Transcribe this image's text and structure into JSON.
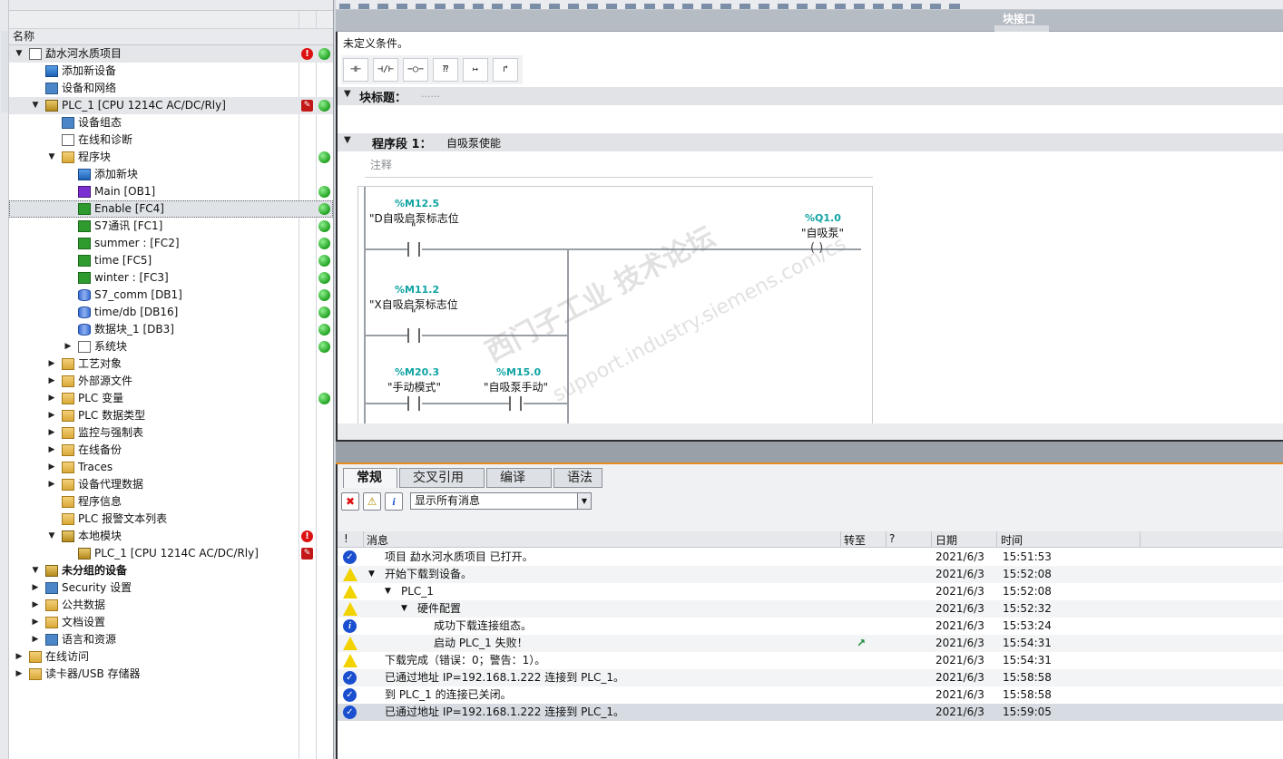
{
  "tree": {
    "header": "名称",
    "rows": [
      {
        "label": "勐水河水质项目",
        "indent": 0,
        "arrow": "down",
        "icon": "project-icon",
        "status1": "error",
        "status2": "ok"
      },
      {
        "label": "添加新设备",
        "indent": 1,
        "arrow": "",
        "icon": "add-device-icon",
        "status1": "",
        "status2": ""
      },
      {
        "label": "设备和网络",
        "indent": 1,
        "arrow": "",
        "icon": "network-icon",
        "status1": "",
        "status2": ""
      },
      {
        "label": "PLC_1 [CPU 1214C AC/DC/Rly]",
        "indent": 1,
        "arrow": "down",
        "icon": "plc-icon",
        "status1": "warn",
        "status2": "ok"
      },
      {
        "label": "设备组态",
        "indent": 2,
        "arrow": "",
        "icon": "device-config-icon",
        "status1": "",
        "status2": ""
      },
      {
        "label": "在线和诊断",
        "indent": 2,
        "arrow": "",
        "icon": "diagnostics-icon",
        "status1": "",
        "status2": ""
      },
      {
        "label": "程序块",
        "indent": 2,
        "arrow": "down",
        "icon": "program-blocks-icon",
        "status1": "",
        "status2": "ok"
      },
      {
        "label": "添加新块",
        "indent": 3,
        "arrow": "",
        "icon": "add-block-icon",
        "status1": "",
        "status2": ""
      },
      {
        "label": "Main [OB1]",
        "indent": 3,
        "arrow": "",
        "icon": "ob-icon",
        "status1": "",
        "status2": "ok"
      },
      {
        "label": "Enable [FC4]",
        "indent": 3,
        "arrow": "",
        "icon": "fc-icon",
        "status1": "",
        "status2": "ok"
      },
      {
        "label": "S7通讯 [FC1]",
        "indent": 3,
        "arrow": "",
        "icon": "fc-icon",
        "status1": "",
        "status2": "ok"
      },
      {
        "label": "summer : [FC2]",
        "indent": 3,
        "arrow": "",
        "icon": "fc-icon",
        "status1": "",
        "status2": "ok"
      },
      {
        "label": "time [FC5]",
        "indent": 3,
        "arrow": "",
        "icon": "fc-icon",
        "status1": "",
        "status2": "ok"
      },
      {
        "label": "winter : [FC3]",
        "indent": 3,
        "arrow": "",
        "icon": "fc-icon",
        "status1": "",
        "status2": "ok"
      },
      {
        "label": "S7_comm [DB1]",
        "indent": 3,
        "arrow": "",
        "icon": "db-icon",
        "status1": "",
        "status2": "ok"
      },
      {
        "label": "time/db [DB16]",
        "indent": 3,
        "arrow": "",
        "icon": "db-icon",
        "status1": "",
        "status2": "ok"
      },
      {
        "label": "数据块_1 [DB3]",
        "indent": 3,
        "arrow": "",
        "icon": "db-icon",
        "status1": "",
        "status2": "ok"
      },
      {
        "label": "系统块",
        "indent": 3,
        "arrow": "right",
        "icon": "system-blocks-icon",
        "status1": "",
        "status2": "ok"
      },
      {
        "label": "工艺对象",
        "indent": 2,
        "arrow": "right",
        "icon": "technology-objects-icon",
        "status1": "",
        "status2": ""
      },
      {
        "label": "外部源文件",
        "indent": 2,
        "arrow": "right",
        "icon": "folder-icon",
        "status1": "",
        "status2": ""
      },
      {
        "label": "PLC 变量",
        "indent": 2,
        "arrow": "right",
        "icon": "plc-tags-icon",
        "status1": "",
        "status2": "ok"
      },
      {
        "label": "PLC 数据类型",
        "indent": 2,
        "arrow": "right",
        "icon": "plc-data-types-icon",
        "status1": "",
        "status2": ""
      },
      {
        "label": "监控与强制表",
        "indent": 2,
        "arrow": "right",
        "icon": "watch-table-icon",
        "status1": "",
        "status2": ""
      },
      {
        "label": "在线备份",
        "indent": 2,
        "arrow": "right",
        "icon": "online-backup-icon",
        "status1": "",
        "status2": ""
      },
      {
        "label": "Traces",
        "indent": 2,
        "arrow": "right",
        "icon": "traces-icon",
        "status1": "",
        "status2": ""
      },
      {
        "label": "设备代理数据",
        "indent": 2,
        "arrow": "right",
        "icon": "proxy-data-icon",
        "status1": "",
        "status2": ""
      },
      {
        "label": "程序信息",
        "indent": 2,
        "arrow": "",
        "icon": "program-info-icon",
        "status1": "",
        "status2": ""
      },
      {
        "label": "PLC 报警文本列表",
        "indent": 2,
        "arrow": "",
        "icon": "alarm-text-icon",
        "status1": "",
        "status2": ""
      },
      {
        "label": "本地模块",
        "indent": 2,
        "arrow": "down",
        "icon": "local-modules-icon",
        "status1": "error",
        "status2": ""
      },
      {
        "label": "PLC_1 [CPU 1214C AC/DC/Rly]",
        "indent": 3,
        "arrow": "",
        "icon": "plc-icon",
        "status1": "warn",
        "status2": ""
      },
      {
        "label": "未分组的设备",
        "indent": 1,
        "arrow": "down",
        "icon": "ungrouped-devices-icon",
        "status1": "",
        "status2": "",
        "bold": true
      },
      {
        "label": "Security 设置",
        "indent": 1,
        "arrow": "right",
        "icon": "security-icon",
        "status1": "",
        "status2": ""
      },
      {
        "label": "公共数据",
        "indent": 1,
        "arrow": "right",
        "icon": "common-data-icon",
        "status1": "",
        "status2": ""
      },
      {
        "label": "文档设置",
        "indent": 1,
        "arrow": "right",
        "icon": "document-settings-icon",
        "status1": "",
        "status2": ""
      },
      {
        "label": "语言和资源",
        "indent": 1,
        "arrow": "right",
        "icon": "languages-icon",
        "status1": "",
        "status2": ""
      },
      {
        "label": "在线访问",
        "indent": 0,
        "arrow": "right",
        "icon": "online-access-icon",
        "status1": "",
        "status2": ""
      },
      {
        "label": "读卡器/USB 存储器",
        "indent": 0,
        "arrow": "right",
        "icon": "card-reader-icon",
        "status1": "",
        "status2": ""
      }
    ]
  },
  "editor": {
    "block_interface": "块接口",
    "condition": "未定义条件。",
    "lad_buttons": [
      "⊣⊢",
      "⊣/⊢",
      "−○−",
      "⁇",
      "↦",
      "↱"
    ],
    "block_title_label": "块标题：",
    "block_title_value": "......",
    "network_label": "程序段 1：",
    "network_title": "自吸泵使能",
    "comment": "注释",
    "contacts": [
      {
        "addr": "%M12.5",
        "tag": "\"D自吸启泵标志位",
        "tag2": "\""
      },
      {
        "addr": "%M11.2",
        "tag": "\"X自吸启泵标志位",
        "tag2": "\""
      },
      {
        "addr": "%M20.3",
        "tag": "\"手动模式\""
      },
      {
        "addr": "%M15.0",
        "tag": "\"自吸泵手动\""
      }
    ],
    "coil": {
      "addr": "%Q1.0",
      "tag": "\"自吸泵\""
    }
  },
  "inspector": {
    "tabs": [
      "常规",
      "交叉引用",
      "编译",
      "语法"
    ],
    "filter": "显示所有消息",
    "columns": {
      "bang": "!",
      "message": "消息",
      "goto": "转至",
      "q": "?",
      "date": "日期",
      "time": "时间"
    },
    "messages": [
      {
        "type": "ok",
        "indent": 0,
        "arrow": "",
        "text": "项目 勐水河水质项目 已打开。",
        "goto": "",
        "date": "2021/6/3",
        "time": "15:51:53"
      },
      {
        "type": "warn",
        "indent": 0,
        "arrow": "down",
        "text": "开始下载到设备。",
        "goto": "",
        "date": "2021/6/3",
        "time": "15:52:08"
      },
      {
        "type": "warn",
        "indent": 1,
        "arrow": "down",
        "text": "PLC_1",
        "goto": "",
        "date": "2021/6/3",
        "time": "15:52:08"
      },
      {
        "type": "warn",
        "indent": 2,
        "arrow": "down",
        "text": "硬件配置",
        "goto": "",
        "date": "2021/6/3",
        "time": "15:52:32"
      },
      {
        "type": "info",
        "indent": 3,
        "arrow": "",
        "text": "成功下载连接组态。",
        "goto": "",
        "date": "2021/6/3",
        "time": "15:53:24"
      },
      {
        "type": "warn",
        "indent": 3,
        "arrow": "",
        "text": "启动 PLC_1 失败！",
        "goto": "↗",
        "date": "2021/6/3",
        "time": "15:54:31"
      },
      {
        "type": "warn",
        "indent": 0,
        "arrow": "",
        "text": "下载完成（错误：0；警告：1）。",
        "goto": "",
        "date": "2021/6/3",
        "time": "15:54:31"
      },
      {
        "type": "ok",
        "indent": 0,
        "arrow": "",
        "text": "已通过地址 IP=192.168.1.222 连接到 PLC_1。",
        "goto": "",
        "date": "2021/6/3",
        "time": "15:58:58"
      },
      {
        "type": "ok",
        "indent": 0,
        "arrow": "",
        "text": "到 PLC_1 的连接已关闭。",
        "goto": "",
        "date": "2021/6/3",
        "time": "15:58:58"
      },
      {
        "type": "ok",
        "indent": 0,
        "arrow": "",
        "text": "已通过地址 IP=192.168.1.222 连接到 PLC_1。",
        "goto": "",
        "date": "2021/6/3",
        "time": "15:59:05"
      }
    ]
  },
  "watermark": {
    "line1": "西门子工业 技术论坛",
    "line2": "support.industry.siemens.com/cs"
  }
}
